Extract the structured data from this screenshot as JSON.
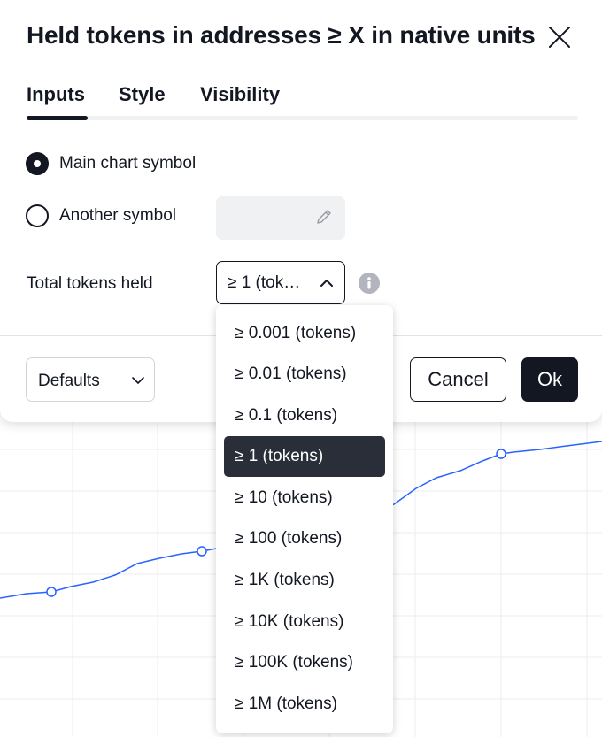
{
  "dialog": {
    "title": "Held tokens in addresses ≥ X in native units",
    "tabs": [
      {
        "label": "Inputs",
        "active": true
      },
      {
        "label": "Style",
        "active": false
      },
      {
        "label": "Visibility",
        "active": false
      }
    ],
    "symbol_options": [
      {
        "label": "Main chart symbol",
        "selected": true
      },
      {
        "label": "Another symbol",
        "selected": false
      }
    ],
    "another_symbol_value": "",
    "total_tokens": {
      "label": "Total tokens held",
      "value": "≥ 1 (tok…"
    },
    "footer": {
      "defaults_label": "Defaults",
      "cancel_label": "Cancel",
      "ok_label": "Ok"
    }
  },
  "dropdown": {
    "options": [
      "≥ 0.001 (tokens)",
      "≥ 0.01 (tokens)",
      "≥ 0.1 (tokens)",
      "≥ 1 (tokens)",
      "≥ 10 (tokens)",
      "≥ 100 (tokens)",
      "≥ 1K (tokens)",
      "≥ 10K (tokens)",
      "≥ 100K (tokens)",
      "≥ 1M (tokens)"
    ],
    "selected_index": 3
  },
  "colors": {
    "text": "#131722",
    "accent_line": "#2962ff",
    "selected_bg": "#2a2e39",
    "muted": "#b2b5be"
  },
  "icons": [
    "close-icon",
    "pencil-icon",
    "chevron-up-icon",
    "info-icon",
    "chevron-down-icon"
  ]
}
